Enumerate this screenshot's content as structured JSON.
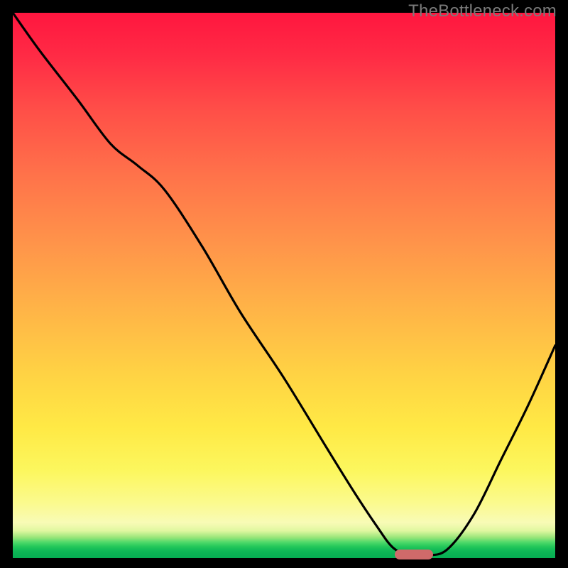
{
  "watermark": "TheBottleneck.com",
  "colors": {
    "frame_bg": "#000000",
    "gradient_top": "#ff163f",
    "gradient_mid_orange": "#ff934a",
    "gradient_yellow": "#ffe945",
    "gradient_lightyellow": "#fbfa8f",
    "gradient_green": "#07ae53",
    "curve_stroke": "#000000",
    "marker_fill": "#cf6a6a"
  },
  "chart_data": {
    "type": "line",
    "title": "",
    "xlabel": "",
    "ylabel": "",
    "xlim": [
      0,
      100
    ],
    "ylim": [
      0,
      100
    ],
    "x": [
      0,
      5,
      12,
      18,
      23,
      28,
      35,
      42,
      50,
      58,
      63,
      67,
      70,
      73,
      76,
      80,
      85,
      90,
      95,
      100
    ],
    "values": [
      100,
      93,
      84,
      76,
      72,
      67.5,
      57,
      45,
      33,
      20,
      12,
      6,
      2,
      0.5,
      0.5,
      1.5,
      8,
      18,
      28,
      39
    ],
    "annotations": [
      {
        "kind": "marker",
        "shape": "pill",
        "x": 74,
        "y": 0.6,
        "color": "#cf6a6a"
      }
    ]
  }
}
